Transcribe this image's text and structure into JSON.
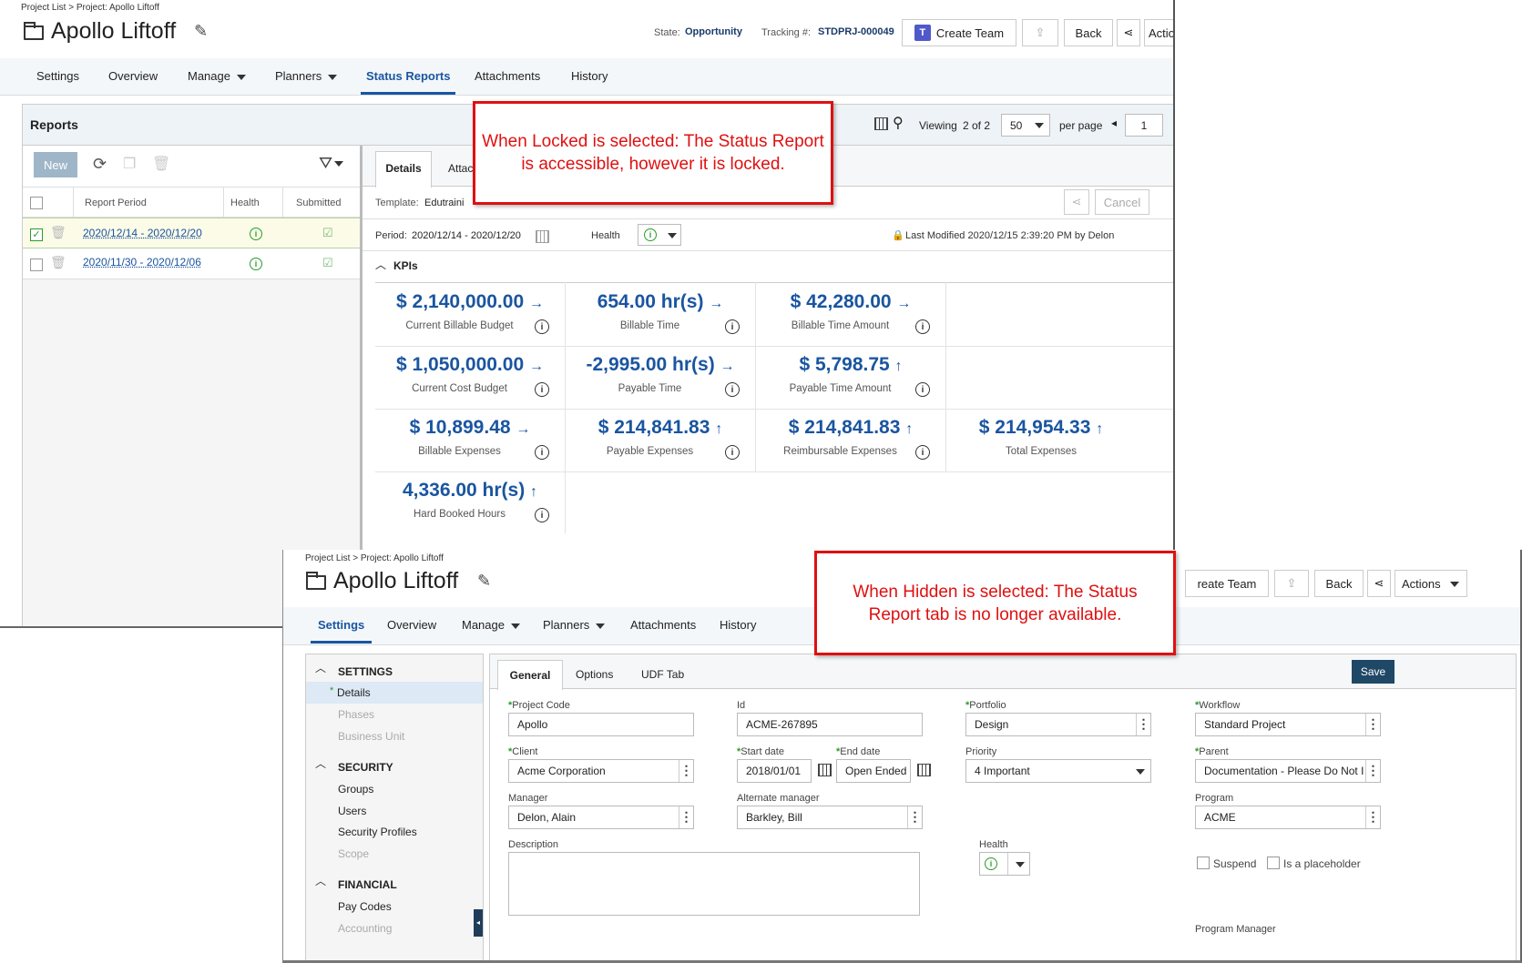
{
  "top": {
    "breadcrumb": "Project List > Project: Apollo Liftoff",
    "title": "Apollo Liftoff",
    "state_label": "State:",
    "state_value": "Opportunity",
    "tracking_label": "Tracking #:",
    "tracking_value": "STDPRJ-000049",
    "create_team": "Create Team",
    "back": "Back",
    "actions": "Actio",
    "tabs": [
      "Settings",
      "Overview",
      "Manage",
      "Planners",
      "Status Reports",
      "Attachments",
      "History"
    ],
    "reports": {
      "header": "Reports",
      "viewing_label": "Viewing",
      "viewing_value": "2 of 2",
      "per_page_value": "50",
      "per_page_label": "per page",
      "page_value": "1",
      "new_button": "New",
      "columns": [
        "Report Period",
        "Health",
        "Submitted"
      ],
      "rows": [
        {
          "period": "2020/12/14 - 2020/12/20"
        },
        {
          "period": "2020/11/30 - 2020/12/06"
        }
      ]
    },
    "details": {
      "tabs": [
        "Details",
        "Attac"
      ],
      "template_label": "Template:",
      "template_value": "Edutraini",
      "cancel": "Cancel",
      "period_label": "Period:",
      "period_value": "2020/12/14 - 2020/12/20",
      "health_label": "Health",
      "last_modified": "Last Modified 2020/12/15 2:39:20 PM by Delon",
      "kpis_label": "KPIs",
      "kpis": [
        {
          "value": "$ 2,140,000.00",
          "trend": "→",
          "label": "Current Billable Budget"
        },
        {
          "value": "654.00 hr(s)",
          "trend": "→",
          "label": "Billable Time"
        },
        {
          "value": "$ 42,280.00",
          "trend": "→",
          "label": "Billable Time Amount"
        },
        {
          "value": "$ 1,050,000.00",
          "trend": "→",
          "label": "Current Cost Budget"
        },
        {
          "value": "-2,995.00 hr(s)",
          "trend": "→",
          "label": "Payable Time"
        },
        {
          "value": "$ 5,798.75",
          "trend": "↑",
          "label": "Payable Time Amount"
        },
        {
          "value": "$ 10,899.48",
          "trend": "→",
          "label": "Billable Expenses"
        },
        {
          "value": "$ 214,841.83",
          "trend": "↑",
          "label": "Payable Expenses"
        },
        {
          "value": "$ 214,841.83",
          "trend": "↑",
          "label": "Reimbursable Expenses"
        },
        {
          "value": "$ 214,954.33",
          "trend": "↑",
          "label": "Total Expenses"
        },
        {
          "value": "4,336.00 hr(s)",
          "trend": "↑",
          "label": "Hard Booked Hours"
        }
      ]
    }
  },
  "callout_locked": "When Locked is selected: The Status Report is accessible, however it is locked.",
  "callout_hidden": "When Hidden is selected: The Status Report tab is no longer available.",
  "bottom": {
    "breadcrumb": "Project List > Project: Apollo Liftoff",
    "title": "Apollo Liftoff",
    "create_team": "reate Team",
    "back": "Back",
    "actions": "Actions",
    "tabs": [
      "Settings",
      "Overview",
      "Manage",
      "Planners",
      "Attachments",
      "History"
    ],
    "sidebar": {
      "settings": "SETTINGS",
      "settings_items": [
        "Details",
        "Phases",
        "Business Unit"
      ],
      "security": "SECURITY",
      "security_items": [
        "Groups",
        "Users",
        "Security Profiles",
        "Scope"
      ],
      "financial": "FINANCIAL",
      "financial_items": [
        "Pay Codes",
        "Accounting"
      ]
    },
    "subtabs": [
      "General",
      "Options",
      "UDF Tab"
    ],
    "save": "Save",
    "fields": {
      "project_code_label": "Project Code",
      "project_code": "Apollo",
      "id_label": "Id",
      "id": "ACME-267895",
      "portfolio_label": "Portfolio",
      "portfolio": "Design",
      "workflow_label": "Workflow",
      "workflow": "Standard Project",
      "client_label": "Client",
      "client": "Acme Corporation",
      "start_label": "Start date",
      "start": "2018/01/01",
      "end_label": "End date",
      "end": "Open Ended",
      "priority_label": "Priority",
      "priority": "4 Important",
      "parent_label": "Parent",
      "parent": "Documentation - Please Do Not I",
      "manager_label": "Manager",
      "manager": "Delon, Alain",
      "alt_manager_label": "Alternate manager",
      "alt_manager": "Barkley, Bill",
      "program_label": "Program",
      "program": "ACME",
      "description_label": "Description",
      "health_label": "Health",
      "suspend_label": "Suspend",
      "placeholder_label": "Is a placeholder",
      "program_manager_label": "Program Manager"
    }
  }
}
